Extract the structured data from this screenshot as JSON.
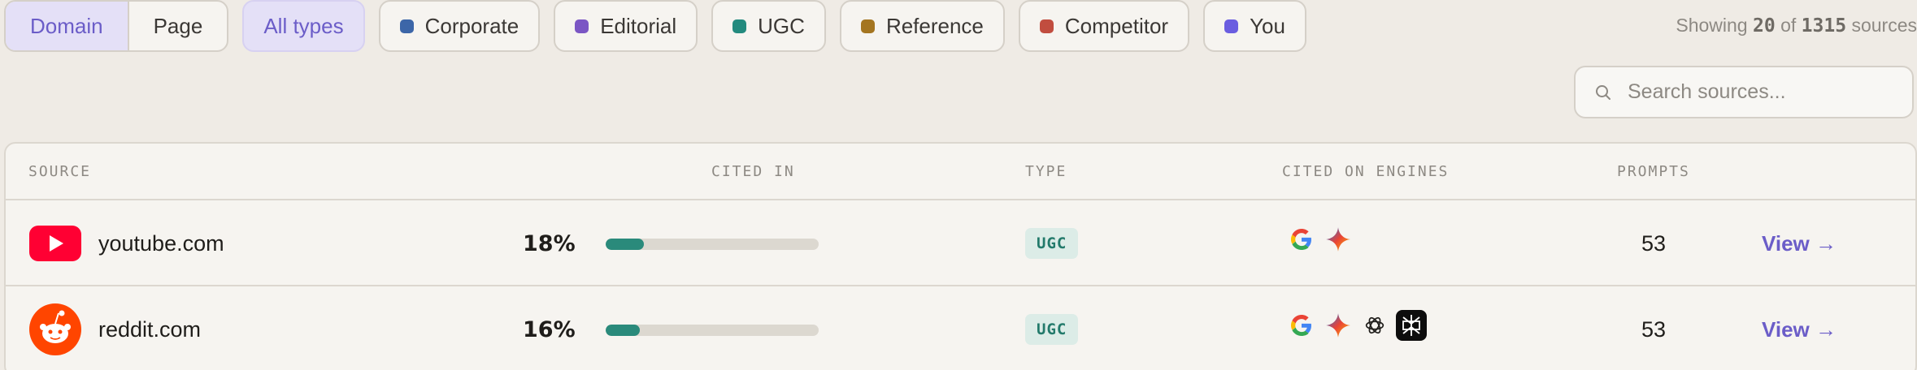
{
  "mode_toggle": {
    "domain": "Domain",
    "page": "Page"
  },
  "filters": [
    {
      "label": "All types",
      "color": ""
    },
    {
      "label": "Corporate",
      "color": "#3c66a8"
    },
    {
      "label": "Editorial",
      "color": "#7b56c4"
    },
    {
      "label": "UGC",
      "color": "#238a7e"
    },
    {
      "label": "Reference",
      "color": "#a47520"
    },
    {
      "label": "Competitor",
      "color": "#c14d3f"
    },
    {
      "label": "You",
      "color": "#6a5de0"
    }
  ],
  "showing": {
    "prefix": "Showing",
    "shown": "20",
    "of": "of",
    "total": "1315",
    "suffix": "sources"
  },
  "search": {
    "placeholder": "Search sources..."
  },
  "table": {
    "headers": {
      "source": "SOURCE",
      "cited_in": "CITED IN",
      "type": "TYPE",
      "engines": "CITED ON ENGINES",
      "prompts": "PROMPTS"
    },
    "rows": [
      {
        "icon": "youtube-icon",
        "domain": "youtube.com",
        "cited_pct": "18%",
        "cited_fraction": 0.18,
        "type": "UGC",
        "engines": [
          "google-icon",
          "gemini-icon"
        ],
        "prompts": "53",
        "action": "View →"
      },
      {
        "icon": "reddit-icon",
        "domain": "reddit.com",
        "cited_pct": "16%",
        "cited_fraction": 0.16,
        "type": "UGC",
        "engines": [
          "google-icon",
          "gemini-icon",
          "chatgpt-icon",
          "perplexity-icon"
        ],
        "prompts": "53",
        "action": "View →"
      }
    ]
  }
}
